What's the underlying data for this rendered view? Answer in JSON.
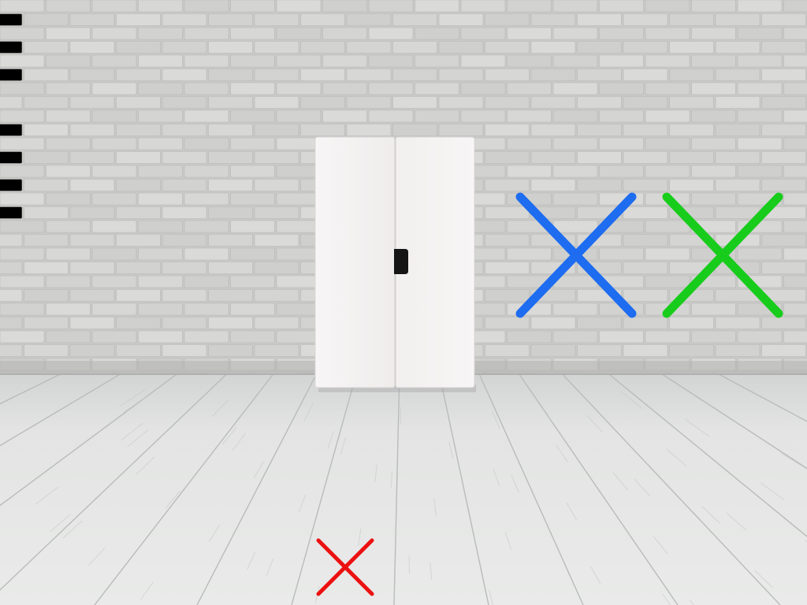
{
  "scene": {
    "objects": {
      "wall": "brick-wall",
      "floor": "wood-plank-floor",
      "cabinet": "white-two-door-cabinet"
    },
    "colors": {
      "wall_base": "#c9c9c7",
      "brick_face": "#d6d6d4",
      "mortar": "#b8b8b6",
      "floor_base": "#e4e5e4",
      "plank_seam": "#b9bcbb",
      "cabinet": "#f5f3f3",
      "handle": "#151515"
    }
  },
  "markers": [
    {
      "label": "blue-x-marker",
      "color": "#1e6cf0"
    },
    {
      "label": "green-x-marker",
      "color": "#18cc1c"
    },
    {
      "label": "red-x-marker",
      "color": "#ec1010"
    }
  ]
}
